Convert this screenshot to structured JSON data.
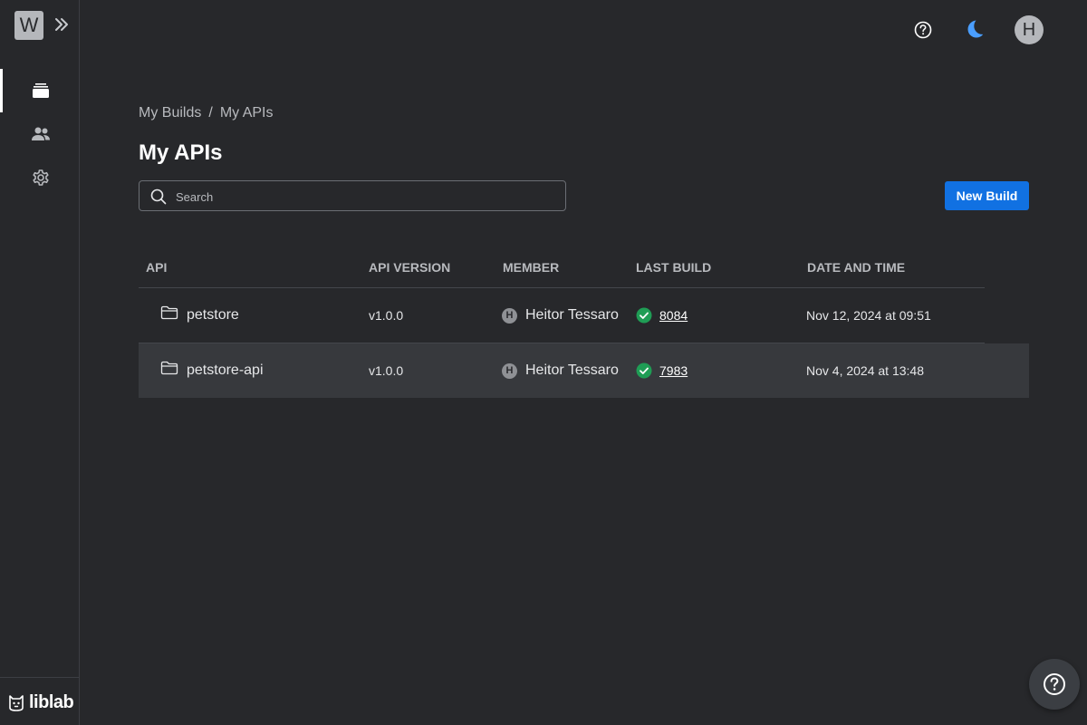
{
  "sidebar": {
    "workspace_badge": "W",
    "nav": [
      {
        "id": "builds",
        "icon": "layers-icon",
        "active": true
      },
      {
        "id": "members",
        "icon": "people-icon"
      },
      {
        "id": "settings",
        "icon": "gear-icon"
      }
    ],
    "brand": "liblab"
  },
  "header": {
    "avatar_initial": "H",
    "icons": [
      "help-icon",
      "moon-icon"
    ],
    "moon_color": "#4a9eff"
  },
  "breadcrumb": {
    "items": [
      "My Builds",
      "My APIs"
    ],
    "separator": "/"
  },
  "page": {
    "title": "My APIs",
    "search_placeholder": "Search",
    "new_build_label": "New Build"
  },
  "table": {
    "columns": [
      "API",
      "API VERSION",
      "MEMBER",
      "LAST BUILD",
      "DATE AND TIME"
    ],
    "rows": [
      {
        "api": "petstore",
        "version": "v1.0.0",
        "member_initial": "H",
        "member": "Heitor Tessaro",
        "build": "8084",
        "status": "success",
        "datetime": "Nov 12, 2024 at 09:51"
      },
      {
        "api": "petstore-api",
        "version": "v1.0.0",
        "member_initial": "H",
        "member": "Heitor Tessaro",
        "build": "7983",
        "status": "success",
        "datetime": "Nov 4, 2024 at 13:48"
      }
    ]
  },
  "colors": {
    "accent": "#1171e2",
    "success": "#1f9d55",
    "background": "#27282b"
  }
}
